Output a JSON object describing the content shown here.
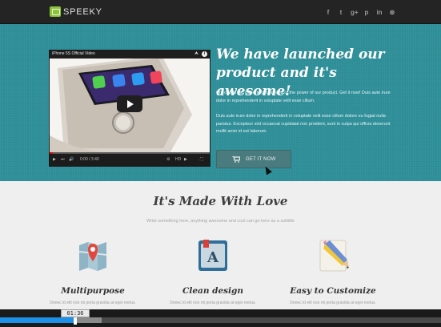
{
  "site": {
    "logo_text": "SPEEKY",
    "social_icons": [
      "facebook-icon",
      "twitter-icon",
      "google-plus-icon",
      "pinterest-icon",
      "linkedin-icon",
      "dribbble-icon"
    ],
    "social_glyphs": [
      "f",
      "t",
      "g+",
      "p",
      "in",
      "⊛"
    ]
  },
  "hero": {
    "video_title": "iPhone 5S Official Video",
    "video_time": "0:00 / 3:40",
    "video_hd": "HD",
    "headline_line1": "We have launched our",
    "headline_line2": "product and it's awesome!",
    "paragraph1": "Check out our video to get an idea of the power of our product. Get it now! Duis aute irure dolor in reprehenderit in voluptate velit esse cillum.",
    "paragraph2": "Duis aute irure dolor in reprehenderit in voluptate velit esse cillum dolore eu fugiat nulla pariatur. Excepteur sint occaecat cupidatat non proident, sunt in culpa qui officia deserunt mollit anim id est laborum.",
    "cta_label": "GET IT NOW"
  },
  "features": {
    "title": "It's Made With Love",
    "subtitle": "Write something here, anything awesome and cool can go here as a subtitle",
    "items": [
      {
        "icon": "map-pin-icon",
        "title": "Multipurpose",
        "desc": "Donec id elit non mi porta gravida at eget metus."
      },
      {
        "icon": "font-book-icon",
        "title": "Clean design",
        "desc": "Donec id elit non mi porta gravida at eget metus."
      },
      {
        "icon": "pencil-icon",
        "title": "Easy to Customize",
        "desc": "Donec id elit non mi porta gravida at eget metus."
      }
    ]
  },
  "player": {
    "timestamp": "01:36",
    "played_fraction": 0.17,
    "buffered_fraction": 0.23
  },
  "colors": {
    "hero_bg": "#2f909a",
    "progress_played": "#1e90e8",
    "logo_green": "#8cc43b"
  }
}
